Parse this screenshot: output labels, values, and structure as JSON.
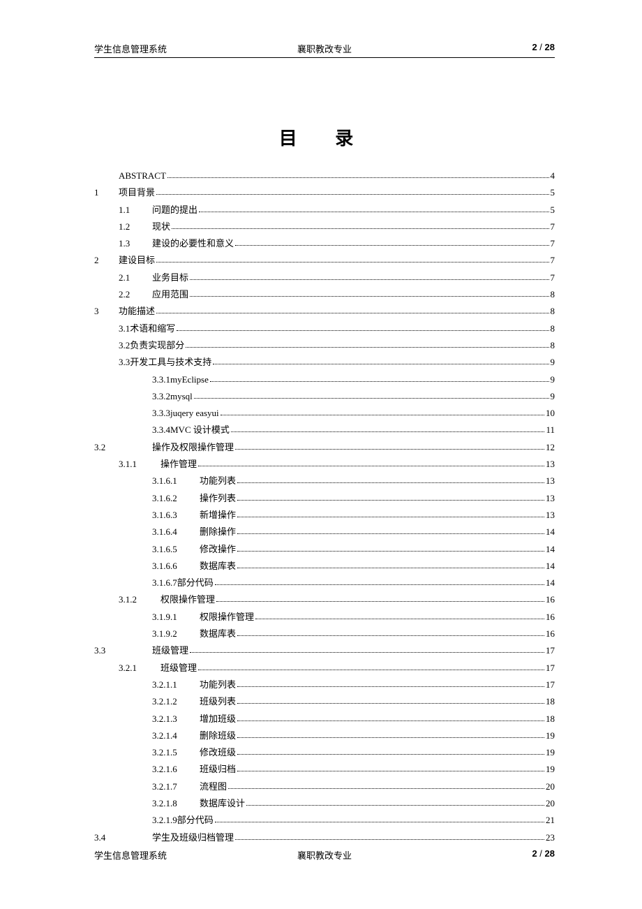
{
  "header": {
    "left": "学生信息管理系统",
    "center": "襄职教改专业",
    "page_current": "2",
    "page_sep": " / ",
    "page_total": "28"
  },
  "footer": {
    "left": "学生信息管理系统",
    "center": "襄职教改专业",
    "page_current": "2",
    "page_sep": " / ",
    "page_total": "28"
  },
  "title": "目 录",
  "toc": [
    {
      "type": "l0b",
      "label": "ABSTRACT",
      "page": "4"
    },
    {
      "type": "l0",
      "num": "1",
      "label": "项目背景",
      "page": "5"
    },
    {
      "type": "l1",
      "num": "1.1",
      "label": "问题的提出",
      "page": "5"
    },
    {
      "type": "l1",
      "num": "1.2",
      "label": "现状",
      "page": "7"
    },
    {
      "type": "l1",
      "num": "1.3",
      "label": "建设的必要性和意义",
      "page": "7"
    },
    {
      "type": "l0",
      "num": "2",
      "label": "建设目标",
      "page": "7"
    },
    {
      "type": "l1",
      "num": "2.1",
      "label": "业务目标",
      "page": "7"
    },
    {
      "type": "l1",
      "num": "2.2",
      "label": "应用范围",
      "page": "8"
    },
    {
      "type": "l0",
      "num": "3",
      "label": "功能描述",
      "page": "8"
    },
    {
      "type": "l1c",
      "num": "3.1",
      "label": "术语和缩写",
      "page": "8"
    },
    {
      "type": "l1c",
      "num": "3.2",
      "label": "负责实现部分",
      "page": "8"
    },
    {
      "type": "l1c",
      "num": "3.3",
      "label": "开发工具与技术支持",
      "page": "9"
    },
    {
      "type": "l2c",
      "num": "3.3.1",
      "label": "myEclipse",
      "page": "9"
    },
    {
      "type": "l2c",
      "num": "3.3.2",
      "label": "mysql",
      "page": "9"
    },
    {
      "type": "l2c",
      "num": "3.3.3",
      "label": "juqery easyui ",
      "page": "10"
    },
    {
      "type": "l2c",
      "num": "3.3.4",
      "label": "MVC 设计模式 ",
      "page": "11"
    },
    {
      "type": "l0n",
      "num": "3.2",
      "label": "操作及权限操作管理",
      "page": "12"
    },
    {
      "type": "l2b",
      "num": "3.1.1",
      "label": "操作管理",
      "page": "13"
    },
    {
      "type": "l3",
      "num": "3.1.6.1",
      "label": "功能列表",
      "page": "13"
    },
    {
      "type": "l3",
      "num": "3.1.6.2",
      "label": "操作列表",
      "page": "13"
    },
    {
      "type": "l3",
      "num": "3.1.6.3",
      "label": "新增操作",
      "page": "13"
    },
    {
      "type": "l3",
      "num": "3.1.6.4",
      "label": "删除操作",
      "page": "14"
    },
    {
      "type": "l3",
      "num": "3.1.6.5",
      "label": "修改操作",
      "page": "14"
    },
    {
      "type": "l3",
      "num": "3.1.6.6",
      "label": "数据库表",
      "page": "14"
    },
    {
      "type": "l3b",
      "num": "3.1.6.7",
      "label": "部分代码",
      "page": "14"
    },
    {
      "type": "l2b",
      "num": "3.1.2",
      "label": "权限操作管理",
      "page": "16"
    },
    {
      "type": "l3",
      "num": "3.1.9.1",
      "label": "权限操作管理",
      "page": "16"
    },
    {
      "type": "l3",
      "num": "3.1.9.2",
      "label": "数据库表",
      "page": "16"
    },
    {
      "type": "l0n",
      "num": "3.3",
      "label": "班级管理",
      "page": "17"
    },
    {
      "type": "l2b",
      "num": "3.2.1",
      "label": "班级管理",
      "page": "17"
    },
    {
      "type": "l3",
      "num": "3.2.1.1",
      "label": "功能列表",
      "page": "17"
    },
    {
      "type": "l3",
      "num": "3.2.1.2",
      "label": "班级列表",
      "page": "18"
    },
    {
      "type": "l3",
      "num": "3.2.1.3",
      "label": "增加班级",
      "page": "18"
    },
    {
      "type": "l3",
      "num": "3.2.1.4",
      "label": "删除班级",
      "page": "19"
    },
    {
      "type": "l3",
      "num": "3.2.1.5",
      "label": "修改班级",
      "page": "19"
    },
    {
      "type": "l3",
      "num": "3.2.1.6",
      "label": "班级归档",
      "page": "19"
    },
    {
      "type": "l3",
      "num": "3.2.1.7",
      "label": "流程图",
      "page": "20"
    },
    {
      "type": "l3",
      "num": "3.2.1.8",
      "label": "数据库设计",
      "page": "20"
    },
    {
      "type": "l3b",
      "num": "3.2.1.9",
      "label": "部分代码",
      "page": "21"
    },
    {
      "type": "l0n",
      "num": "3.4",
      "label": "学生及班级归档管理",
      "page": "23"
    }
  ]
}
